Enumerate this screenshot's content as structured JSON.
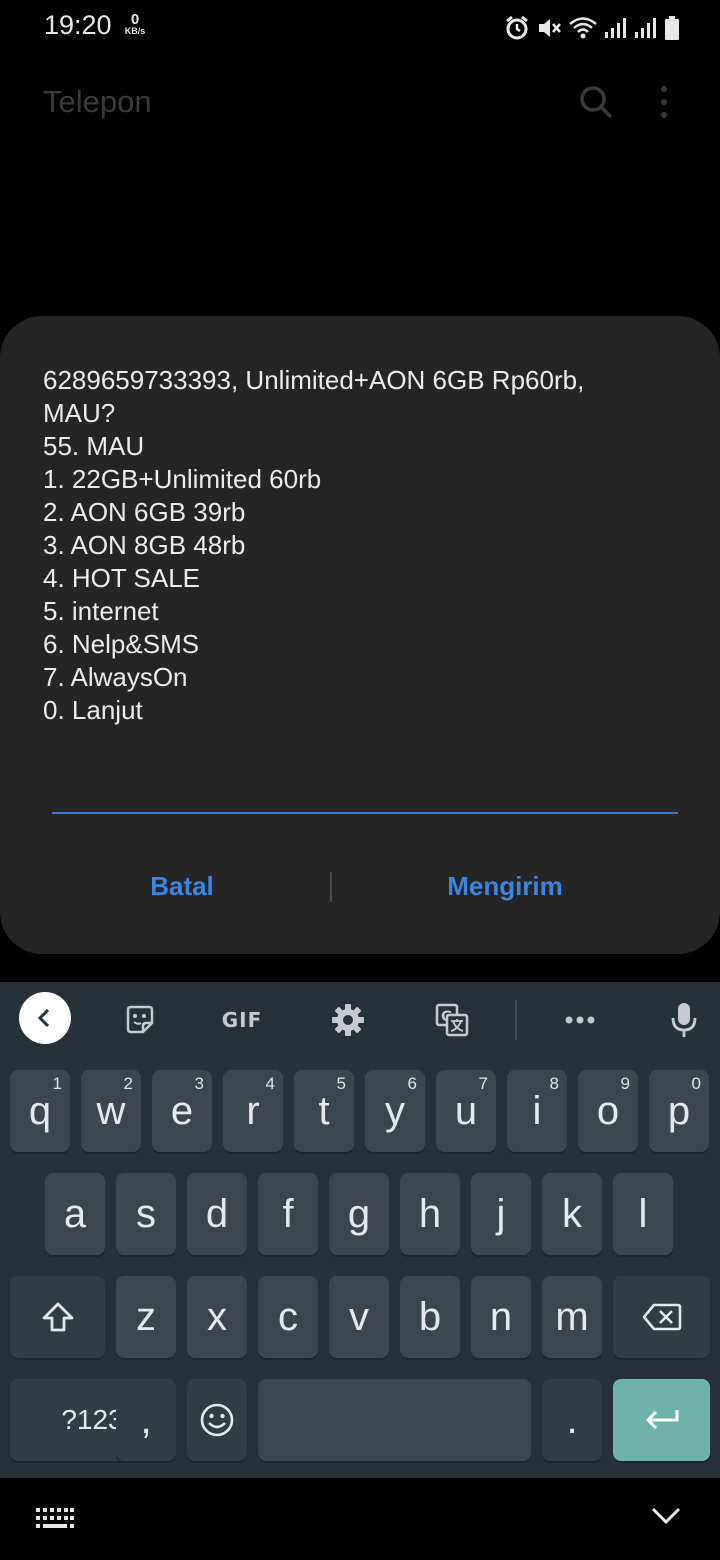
{
  "status_bar": {
    "time": "19:20",
    "speed_value": "0",
    "speed_unit": "KB/s",
    "icons": [
      "alarm-icon",
      "mute-icon",
      "wifi-icon",
      "signal-icon",
      "signal-icon",
      "battery-icon"
    ]
  },
  "app": {
    "title": "Telepon",
    "icons": [
      "search-icon",
      "more-vert-icon"
    ]
  },
  "dialog": {
    "message": "6289659733393, Unlimited+AON 6GB Rp60rb,\nMAU?\n55. MAU\n1. 22GB+Unlimited 60rb\n2. AON 6GB 39rb\n3. AON 8GB 48rb\n4. HOT SALE\n5. internet\n6. Nelp&SMS\n7. AlwaysOn\n0. Lanjut",
    "input_value": "",
    "cancel_label": "Batal",
    "send_label": "Mengirim",
    "accent_color": "#3d85e0"
  },
  "keyboard": {
    "toolbar": {
      "gif_label": "GIF",
      "icons": [
        "back-arrow-icon",
        "sticker-icon",
        "gif-icon",
        "settings-icon",
        "translate-icon",
        "more-horiz-icon",
        "mic-icon"
      ]
    },
    "row1": [
      {
        "key": "q",
        "hint": "1"
      },
      {
        "key": "w",
        "hint": "2"
      },
      {
        "key": "e",
        "hint": "3"
      },
      {
        "key": "r",
        "hint": "4"
      },
      {
        "key": "t",
        "hint": "5"
      },
      {
        "key": "y",
        "hint": "6"
      },
      {
        "key": "u",
        "hint": "7"
      },
      {
        "key": "i",
        "hint": "8"
      },
      {
        "key": "o",
        "hint": "9"
      },
      {
        "key": "p",
        "hint": "0"
      }
    ],
    "row2": [
      "a",
      "s",
      "d",
      "f",
      "g",
      "h",
      "j",
      "k",
      "l"
    ],
    "row3": [
      "z",
      "x",
      "c",
      "v",
      "b",
      "n",
      "m"
    ],
    "row4": {
      "symbols_label": "?123",
      "comma": ",",
      "period": "."
    },
    "enter_color": "#6fb2aa"
  },
  "nav_bar": {
    "icons": [
      "keyboard-switch-icon",
      "hide-keyboard-icon"
    ]
  }
}
